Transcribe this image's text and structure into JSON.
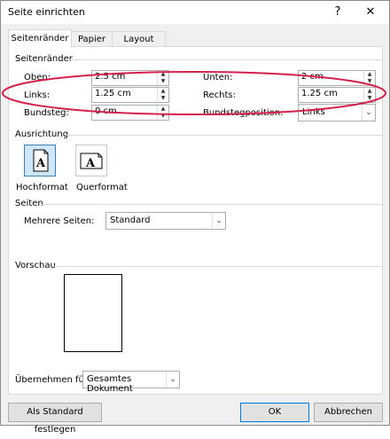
{
  "window": {
    "title": "Seite einrichten",
    "help_glyph": "?",
    "close_glyph": "✕"
  },
  "tabs": [
    {
      "label": "Seitenränder"
    },
    {
      "label": "Papier"
    },
    {
      "label": "Layout"
    }
  ],
  "margins": {
    "heading": "Seitenränder",
    "top_label": "Oben:",
    "top_value": "2.5 cm",
    "bottom_label": "Unten:",
    "bottom_value": "2 cm",
    "left_label": "Links:",
    "left_value": "1.25 cm",
    "right_label": "Rechts:",
    "right_value": "1.25 cm",
    "gutter_label": "Bundsteg:",
    "gutter_value": "0 cm",
    "gutter_pos_label": "Bundstegposition:",
    "gutter_pos_value": "Links"
  },
  "orientation": {
    "heading": "Ausrichtung",
    "portrait_label": "Hochformat",
    "landscape_label": "Querformat",
    "icon_letter": "A"
  },
  "pages": {
    "heading": "Seiten",
    "multiple_label": "Mehrere Seiten:",
    "multiple_value": "Standard"
  },
  "preview": {
    "heading": "Vorschau"
  },
  "apply": {
    "label": "Übernehmen für:",
    "value": "Gesamtes Dokument"
  },
  "buttons": {
    "default": "Als Standard festlegen",
    "ok": "OK",
    "cancel": "Abbrechen"
  },
  "annotation_color": "#d6204c"
}
